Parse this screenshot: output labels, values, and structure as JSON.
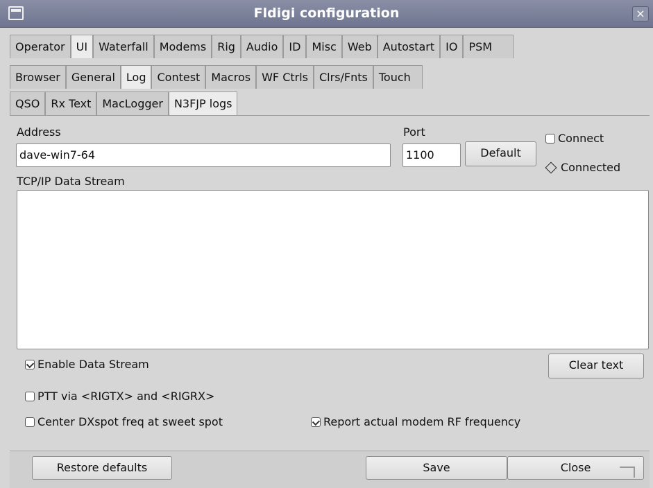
{
  "window": {
    "title": "Fldigi configuration",
    "close_label": "×"
  },
  "tabs_row1": [
    "Operator",
    "UI",
    "Waterfall",
    "Modems",
    "Rig",
    "Audio",
    "ID",
    "Misc",
    "Web",
    "Autostart",
    "IO",
    "PSM"
  ],
  "tabs_row1_active": "UI",
  "tabs_row2": [
    "Browser",
    "General",
    "Log",
    "Contest",
    "Macros",
    "WF Ctrls",
    "Clrs/Fnts",
    "Touch"
  ],
  "tabs_row2_active": "Log",
  "tabs_row3": [
    "QSO",
    "Rx Text",
    "MacLogger",
    "N3FJP logs"
  ],
  "tabs_row3_active": "N3FJP logs",
  "connection": {
    "address_label": "Address",
    "address_value": "dave-win7-64",
    "port_label": "Port",
    "port_value": "1100",
    "default_label": "Default",
    "connect_label": "Connect",
    "connect_checked": false,
    "connected_label": "Connected"
  },
  "stream": {
    "label": "TCP/IP Data Stream",
    "content": ""
  },
  "options": {
    "enable_stream_label": "Enable Data Stream",
    "enable_stream_checked": true,
    "clear_text_label": "Clear text",
    "ptt_label": "PTT via <RIGTX> and <RIGRX>",
    "ptt_checked": false,
    "center_dxspot_label": "Center DXspot freq at sweet spot",
    "center_dxspot_checked": false,
    "report_rf_label": "Report actual modem RF frequency",
    "report_rf_checked": true
  },
  "footer": {
    "restore_label": "Restore defaults",
    "save_label": "Save",
    "close_label": "Close"
  }
}
